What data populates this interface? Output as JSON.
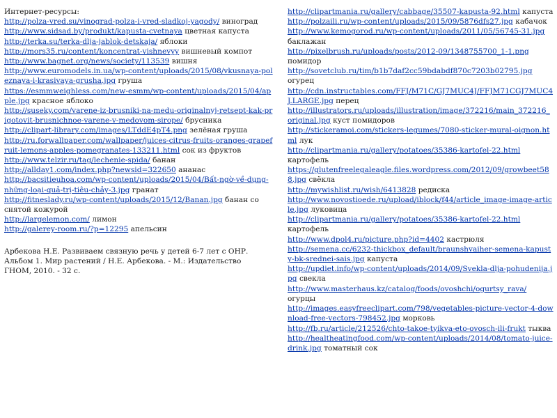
{
  "left": {
    "heading": "Интернет-ресурсы:",
    "entries": [
      {
        "url": "http://polza-vred.su/vinograd-polza-i-vred-sladkoj-yagody/",
        "label": "виноград"
      },
      {
        "url": "http://www.sidsad.by/produkt/kapusta-cvetnaya",
        "label": "цветная капуста"
      },
      {
        "url": "http://terka.su/terka-dlja-jablok-detskaja/",
        "label": "яблоки"
      },
      {
        "url": "http://mors35.ru/content/koncentrat-vishnevyy",
        "label": "вишневый компот"
      },
      {
        "url": "http://www.bagnet.org/news/society/113539",
        "label": "вишня"
      },
      {
        "url": "http://www.euromodels.in.ua/wp-content/uploads/2015/08/vkusnaya-poleznaya-i-krasivaya-grusha.jpg",
        "label": "груша"
      },
      {
        "url": "https://esmmweighless.com/new-esmm/wp-content/uploads/2015/04/apple.jpg",
        "label": "красное яблоко"
      },
      {
        "url": "http://suseky.com/varene-iz-brusniki-na-medu-originalnyj-retsept-kak-prigotovit-brusnichnoe-varene-v-medovom-sirope/",
        "label": "брусника"
      },
      {
        "url": "http://clipart-library.com/images/LTddE4pT4.png",
        "label": "зелёная груша"
      },
      {
        "url": "http://ru.forwallpaper.com/wallpaper/juices-citrus-fruits-oranges-grapefruit-lemons-apples-pomegranates-133211.html",
        "label": "сок из фруктов"
      },
      {
        "url": "http://www.telzir.ru/tag/lechenie-spida/",
        "label": "банан"
      },
      {
        "url": "http://allday1.com/index.php?newsid=322650",
        "label": "ананас"
      },
      {
        "url": "http://bacsitieuhoa.com/wp-content/uploads/2015/04/Bất-ngờ-về-dụng-những-loại-quả-trị-tiêu-chảy-3.jpg",
        "label": "гранат"
      },
      {
        "url": "http://fitneslady.ru/wp-content/uploads/2015/12/Banan.jpg",
        "label": "банан со снятой кожурой"
      },
      {
        "url": "http://largelemon.com/",
        "label": "лимон"
      },
      {
        "url": "http://galerey-room.ru/?p=12295",
        "label": "апельсин"
      }
    ],
    "citation": "Арбекова Н.Е. Развиваем связную речь у детей 6-7 лет с ОНР. Альбом 1. Мир растений / Н.Е. Арбекова. - М.: Издательство ГНОМ, 2010. - 32 с."
  },
  "right": {
    "entries": [
      {
        "url": "http://clipartmania.ru/gallery/cabbage/35507-kapusta-92.html",
        "label": "капуста"
      },
      {
        "url": "http://polzaili.ru/wp-content/uploads/2015/09/5876dfs27.jpg",
        "label": "кабачок"
      },
      {
        "url": "http://www.kemogorod.ru/wp-content/uploads/2011/05/56745-31.jpg",
        "label": "баклажан"
      },
      {
        "url": "http://pixelbrush.ru/uploads/posts/2012-09/1348755700_1-1.png",
        "label": "помидор"
      },
      {
        "url": "http://sovetclub.ru/tim/b1b7daf2cc59bdabdf870c7203b02795.jpg",
        "label": "огурец"
      },
      {
        "url": "http://cdn.instructables.com/FFJ/M71C/GJ7MUC4J/FFJM71CGJ7MUC4J.LARGE.jpg",
        "label": "перец"
      },
      {
        "url": "http://illustrators.ru/uploads/illustration/image/372216/main_372216_original.jpg",
        "label": "куст помидоров"
      },
      {
        "url": "http://stickeramoi.com/stickers-legumes/7080-sticker-mural-oignon.html",
        "label": "лук"
      },
      {
        "url": "http://clipartmania.ru/gallery/potatoes/35386-kartofel-22.html",
        "label": "картофель"
      },
      {
        "url": "https://glutenfreelegaleagle.files.wordpress.com/2012/09/growbeet588.jpg",
        "label": "свёкла"
      },
      {
        "url": "http://mywishlist.ru/wish/6413828",
        "label": "редиска"
      },
      {
        "url": "http://www.novostioede.ru/upload/iblock/f44/article_image-image-article.jpg",
        "label": "луковица"
      },
      {
        "url": "http://clipartmania.ru/gallery/potatoes/35386-kartofel-22.html",
        "label": "картофель"
      },
      {
        "url": "http://www.dpol4.ru/picture.php?id=4402",
        "label": "кастрюля"
      },
      {
        "url": "http://semena.cc/6232-thickbox_default/braunshvaiher-semena-kapusty-bk-srednei-sais.jpg",
        "label": "капуста"
      },
      {
        "url": "http://updiet.info/wp-content/uploads/2014/09/Svekla-dlja-pohudenija.jpg",
        "label": "свекла"
      },
      {
        "url": "http://www.masterhaus.kz/catalog/foods/ovoshchi/ogurtsy_rava/",
        "label": "огурцы"
      },
      {
        "url": "http://images.easyfreeclipart.com/798/vegetables-picture-vector-4-download-free-vectors-798452.jpg",
        "label": "морковь"
      },
      {
        "url": "http://fb.ru/article/212526/chto-takoe-tyikva-eto-ovosch-ili-frukt",
        "label": "тыква"
      },
      {
        "url": "http://healtheatingfood.com/wp-content/uploads/2014/08/tomato-juice-drink.jpg",
        "label": "томатный сок"
      }
    ]
  }
}
